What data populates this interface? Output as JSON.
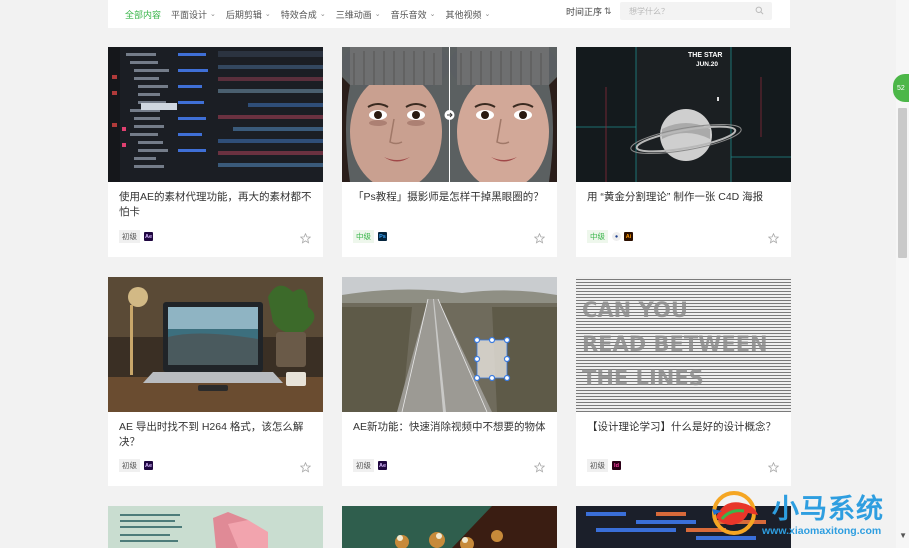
{
  "filters": {
    "items": [
      {
        "label": "全部内容",
        "active": true
      },
      {
        "label": "平面设计",
        "caret": true
      },
      {
        "label": "后期剪辑",
        "caret": true
      },
      {
        "label": "特效合成",
        "caret": true
      },
      {
        "label": "三维动画",
        "caret": true
      },
      {
        "label": "音乐音效",
        "caret": true
      },
      {
        "label": "其他视频",
        "caret": true
      }
    ],
    "sort_label": "时间正序",
    "search_placeholder": "想学什么？"
  },
  "cards": [
    {
      "title": "使用AE的素材代理功能，再大的素材都不怕卡",
      "level": "初级",
      "level_type": "basic",
      "software": [
        "Ae"
      ]
    },
    {
      "title": "「Ps教程」摄影师是怎样干掉黑眼圈的？",
      "level": "中级",
      "level_type": "mid",
      "software": [
        "Ps"
      ]
    },
    {
      "title": "用 “黄金分割理论” 制作一张 C4D 海报",
      "level": "中级",
      "level_type": "mid",
      "software": [
        "C4D",
        "Ai"
      ]
    },
    {
      "title": "AE 导出时找不到 H264 格式，该怎么解决？",
      "level": "初级",
      "level_type": "basic",
      "software": [
        "Ae"
      ]
    },
    {
      "title": "AE新功能：快速消除视频中不想要的物体",
      "level": "初级",
      "level_type": "basic",
      "software": [
        "Ae"
      ]
    },
    {
      "title": "【设计理论学习】什么是好的设计概念？",
      "level": "初级",
      "level_type": "basic",
      "software": [
        "Id"
      ]
    }
  ],
  "thumb_text": {
    "star_poster": "THE STAR",
    "star_date": "JUN.20",
    "read_between": [
      "CAN YOU",
      "READ BETWEEN",
      "THE LINES"
    ]
  },
  "side_badge": "52",
  "watermark": {
    "title": "小马系统",
    "url": "www.xiaomaxitong.com"
  },
  "colors": {
    "accent": "#39b54a",
    "watermark": "#2e9ee0"
  }
}
